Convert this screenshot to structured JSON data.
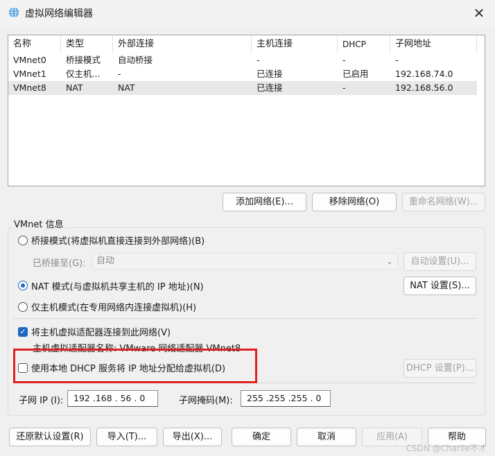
{
  "window": {
    "title": "虚拟网络编辑器",
    "icon": "network-globe-icon",
    "close_label": "✕"
  },
  "network_list": {
    "columns": [
      "名称",
      "类型",
      "外部连接",
      "主机连接",
      "DHCP",
      "子网地址"
    ],
    "rows": [
      [
        "VMnet0",
        "桥接模式",
        "自动桥接",
        "-",
        "-",
        "-"
      ],
      [
        "VMnet1",
        "仅主机...",
        "-",
        "已连接",
        "已启用",
        "192.168.74.0"
      ],
      [
        "VMnet8",
        "NAT",
        "NAT",
        "已连接",
        "-",
        "192.168.56.0"
      ]
    ],
    "selected_row": 2
  },
  "list_buttons": {
    "add": "添加网络(E)...",
    "remove": "移除网络(O)",
    "rename": "重命名网络(W)..."
  },
  "vmnet_info": {
    "legend": "VMnet 信息",
    "bridged_radio": "桥接模式(将虚拟机直接连接到外部网络)(B)",
    "bridged_to_label": "已桥接至(G):",
    "bridged_to_value": "自动",
    "auto_settings_button": "自动设置(U)...",
    "nat_radio": "NAT 模式(与虚拟机共享主机的 IP 地址)(N)",
    "nat_settings_button": "NAT 设置(S)...",
    "host_only_radio": "仅主机模式(在专用网络内连接虚拟机)(H)",
    "selected_mode": "nat",
    "connect_adapter_checkbox": "将主机虚拟适配器连接到此网络(V)",
    "connect_adapter_checked": true,
    "adapter_name_text": "主机虚拟适配器名称: VMware 网络适配器 VMnet8",
    "dhcp_checkbox": "使用本地 DHCP 服务将 IP 地址分配给虚拟机(D)",
    "dhcp_checked": false,
    "dhcp_settings_button": "DHCP 设置(P)...",
    "subnet_ip_label": "子网 IP (I):",
    "subnet_ip_value": "192 .168 . 56 . 0",
    "subnet_mask_label": "子网掩码(M):",
    "subnet_mask_value": "255 .255 .255 . 0"
  },
  "footer_buttons": {
    "restore": "还原默认设置(R)",
    "import": "导入(T)...",
    "export": "导出(X)...",
    "ok": "确定",
    "cancel": "取消",
    "apply": "应用(A)",
    "help": "帮助"
  },
  "watermark": "CSDN @Charlie不才",
  "colors": {
    "accent": "#1f67c2",
    "highlight_box": "#e02020",
    "selected_row": "#e8e8e8"
  }
}
